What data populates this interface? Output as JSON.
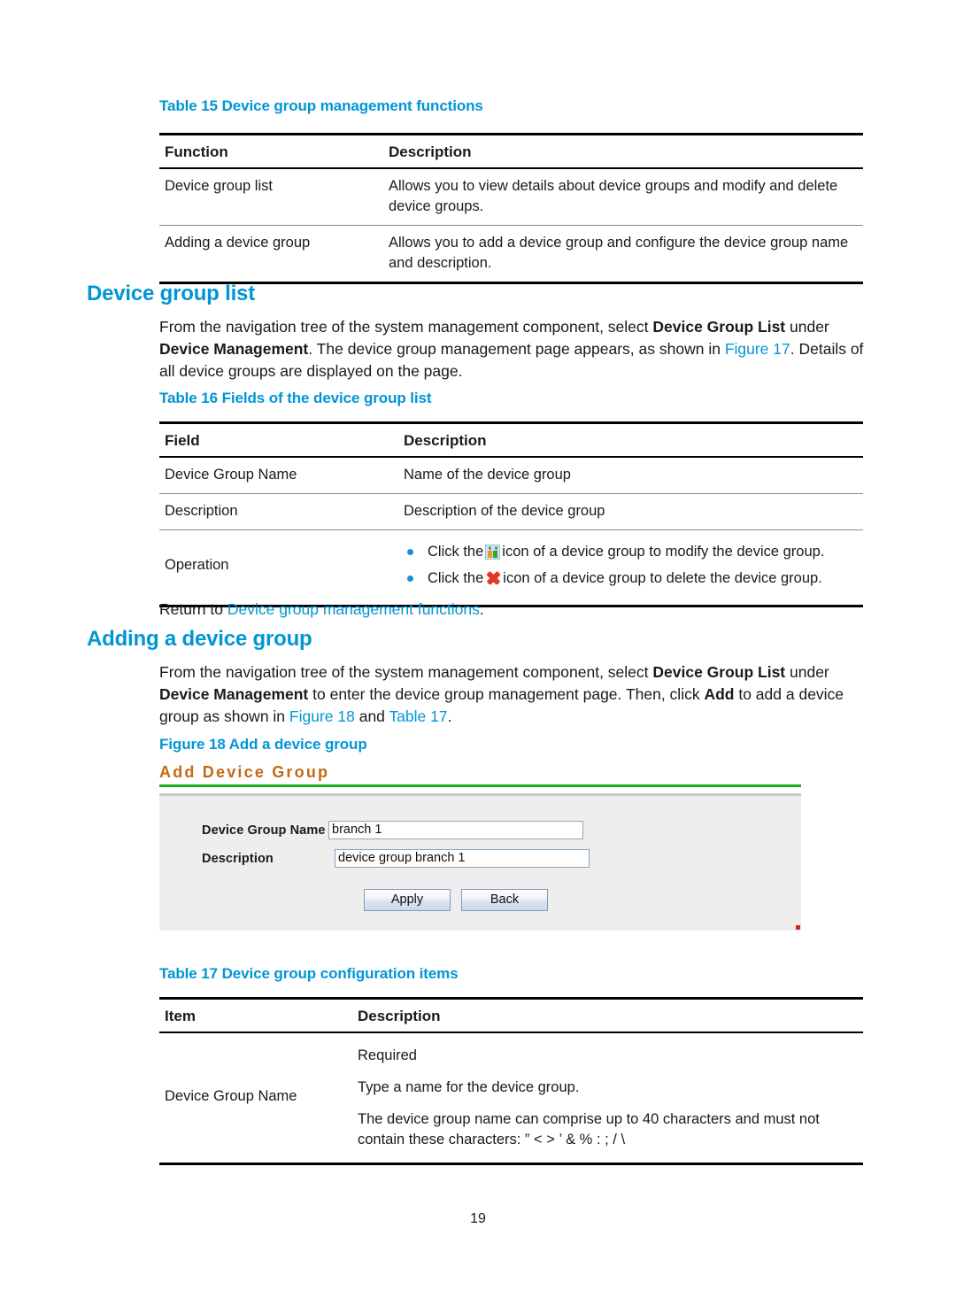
{
  "page": {
    "number": "19",
    "accent_blue": "#0096d6",
    "shot_title_color": "#c36a16",
    "shot_rule_color": "#13b313"
  },
  "table15": {
    "caption": "Table 15 Device group management functions",
    "headers": [
      "Function",
      "Description"
    ],
    "rows": [
      {
        "function": "Device group list",
        "description": "Allows you to view details about device groups and modify and delete device groups."
      },
      {
        "function": "Adding a device group",
        "description": "Allows you to add a device group and configure the device group name and description."
      }
    ]
  },
  "section_device_group_list": {
    "heading": "Device group list",
    "paragraph": {
      "part1": "From the navigation tree of the system management component, select ",
      "bold1": "Device Group List",
      "part2": " under ",
      "bold2": "Device Management",
      "part3": ". The device group management page appears, as shown in ",
      "link1": "Figure 17",
      "part4": ". Details of all device groups are displayed on the page."
    }
  },
  "table16": {
    "caption": "Table 16 Fields of the device group list",
    "headers": [
      "Field",
      "Description"
    ],
    "rows": [
      {
        "field": "Device Group Name",
        "description": "Name of the device group"
      },
      {
        "field": "Description",
        "description": "Description of the device group"
      }
    ],
    "operation": {
      "field": "Operation",
      "bullets": [
        {
          "before": "Click the",
          "icon": "modify-device-group-icon",
          "after": "icon of a device group to modify the device group."
        },
        {
          "before": "Click the",
          "icon": "delete-device-group-icon",
          "after": "icon of a device group to delete the device group."
        }
      ]
    }
  },
  "return_line": {
    "prefix": "Return to ",
    "link": "Device group management functions",
    "suffix": "."
  },
  "section_adding_device_group": {
    "heading": "Adding a device group",
    "paragraph": {
      "part1": "From the navigation tree of the system management component, select ",
      "bold1": "Device Group List",
      "part2": " under ",
      "bold2": "Device Management",
      "part3": " to enter the device group management page. Then, click ",
      "bold3": "Add",
      "part4": " to add a device group as shown in ",
      "link1": "Figure 18",
      "part5": " and ",
      "link2": "Table 17",
      "part6": "."
    }
  },
  "figure18": {
    "caption": "Figure 18 Add a device group",
    "screenshot": {
      "title": "Add Device Group",
      "fields": [
        {
          "label": "Device Group Name",
          "value": "branch 1"
        },
        {
          "label": "Description",
          "value": "device group branch 1"
        }
      ],
      "buttons": [
        {
          "label": "Apply"
        },
        {
          "label": "Back"
        }
      ]
    }
  },
  "table17": {
    "caption": "Table 17 Device group configuration items",
    "headers": [
      "Item",
      "Description"
    ],
    "row": {
      "item": "Device Group Name",
      "lines": [
        "Required",
        "Type a name for the device group.",
        "The device group name can comprise up to 40 characters and must not contain these characters: ” < > ’ & % : ; / \\"
      ]
    }
  }
}
